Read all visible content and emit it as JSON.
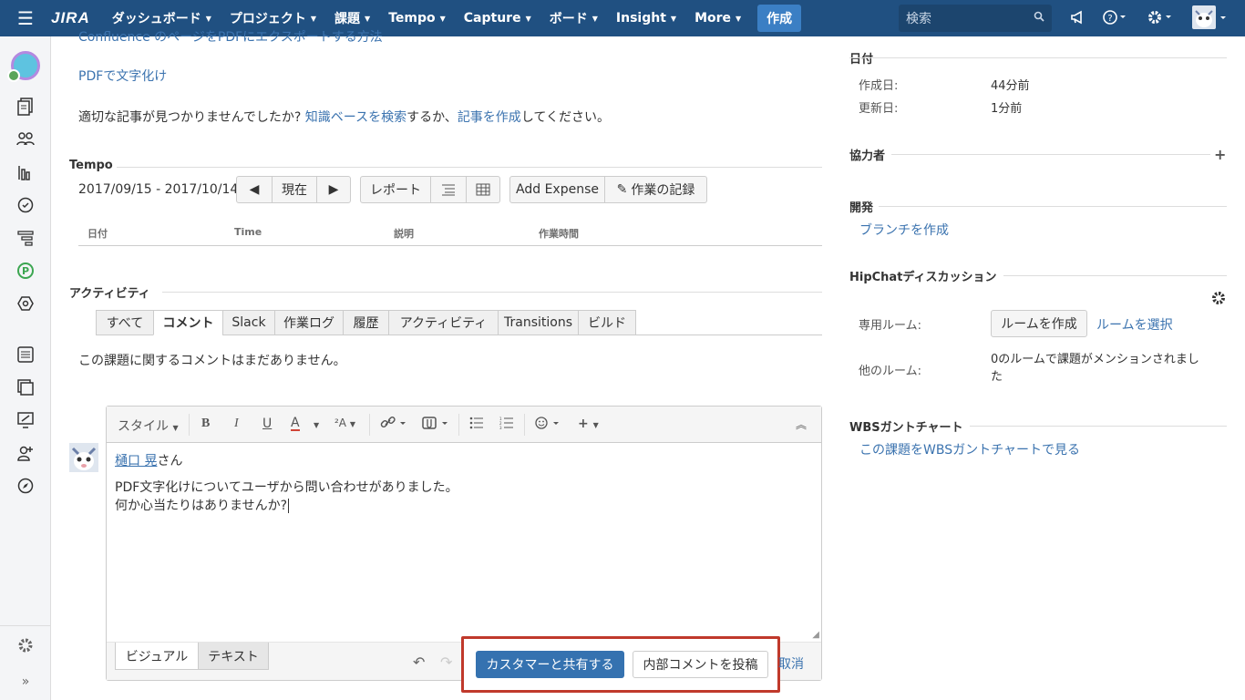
{
  "topnav": {
    "logo": "JIRA",
    "items": [
      "ダッシュボード",
      "プロジェクト",
      "課題",
      "Tempo",
      "Capture",
      "ボード",
      "Insight",
      "More"
    ],
    "create": "作成",
    "search_placeholder": "検索"
  },
  "main": {
    "partial_link": "Confluence のページをPDFにエクスポートする方法",
    "link_pdf": "PDFで文字化け",
    "notfound_prefix": "適切な記事が見つかりませんでしたか?",
    "notfound_link1": "知識ベースを検索",
    "notfound_mid": "するか、",
    "notfound_link2": "記事を作成",
    "notfound_suffix": "してください。",
    "tempo": {
      "title": "Tempo",
      "date_range": "2017/09/15 - 2017/10/14",
      "now": "現在",
      "report": "レポート",
      "add_expense": "Add Expense",
      "log_work": "作業の記録",
      "columns": [
        "日付",
        "Time",
        "説明",
        "作業時間"
      ]
    },
    "activity": {
      "title": "アクティビティ",
      "tabs": [
        "すべて",
        "コメント",
        "Slack",
        "作業ログ",
        "履歴",
        "アクティビティ",
        "Transitions",
        "ビルド"
      ],
      "empty": "この課題に関するコメントはまだありません。"
    },
    "editor": {
      "style": "スタイル",
      "mention": "樋口 晃",
      "mention_suffix": "さん",
      "line1": "PDF文字化けについてユーザから問い合わせがありました。",
      "line2": "何か心当たりはありませんか?",
      "tab_visual": "ビジュアル",
      "tab_text": "テキスト",
      "share": "カスタマーと共有する",
      "internal": "内部コメントを投稿",
      "cancel": "取消"
    }
  },
  "right": {
    "date": {
      "title": "日付",
      "created_label": "作成日:",
      "created_value": "44分前",
      "updated_label": "更新日:",
      "updated_value": "1分前"
    },
    "collab": {
      "title": "協力者"
    },
    "dev": {
      "title": "開発",
      "link": "ブランチを作成"
    },
    "hipchat": {
      "title": "HipChatディスカッション",
      "room_label": "専用ルーム:",
      "create_room": "ルームを作成",
      "select_room": "ルームを選択",
      "other_label": "他のルーム:",
      "other_value1": "0のルームで課題がメンションされまし",
      "other_value2": "た"
    },
    "wbs": {
      "title": "WBSガントチャート",
      "link": "この課題をWBSガントチャートで見る"
    }
  },
  "colors": {
    "nav_bg": "#205081",
    "primary_button": "#3572b0",
    "highlight_border": "#c0392b",
    "link": "#3b73af"
  }
}
